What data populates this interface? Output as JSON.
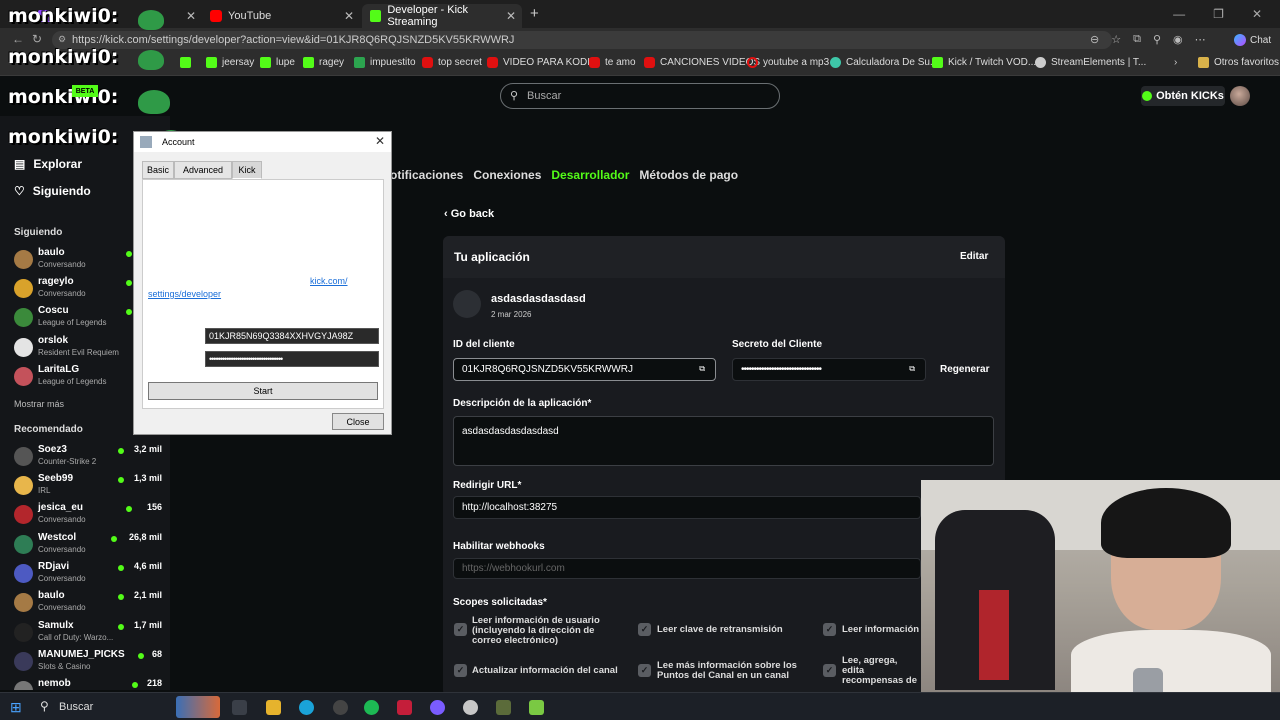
{
  "browser": {
    "tabs": [
      {
        "label": "",
        "favicon_color": "#9146ff"
      },
      {
        "label": "YouTube",
        "favicon_color": "#ff0000"
      },
      {
        "label": "Developer - Kick Streaming",
        "favicon_color": "#53fc18"
      }
    ],
    "url": "https://kick.com/settings/developer?action=view&id=01KJR8Q6RQJSNZD5KV55KRWWRJ",
    "bookmarks": [
      "jeersay",
      "lupe",
      "ragey",
      "impuestito",
      "top secret",
      "VIDEO PARA KODI...",
      "te amo",
      "CANCIONES VIDEOS",
      "youtube a mp3",
      "Calculadora De Su...",
      "Kick / Twitch VOD...",
      "StreamElements | T..."
    ],
    "other_favorites": "Otros favoritos",
    "chat_label": "Chat"
  },
  "header": {
    "search_placeholder": "Buscar",
    "get_kicks": "Obtén KICKs"
  },
  "overlay": {
    "name": "monkiwi0:",
    "beta": "BETA"
  },
  "sidebar": {
    "nav": [
      "Explorar",
      "Siguiendo"
    ],
    "following_title": "Siguiendo",
    "following": [
      {
        "name": "baulo",
        "sub": "Conversando"
      },
      {
        "name": "rageylo",
        "sub": "Conversando"
      },
      {
        "name": "Coscu",
        "sub": "League of Legends"
      },
      {
        "name": "orslok",
        "sub": "Resident Evil Requiem"
      },
      {
        "name": "LaritaLG",
        "sub": "League of Legends"
      }
    ],
    "show_more": "Mostrar más",
    "recommended_title": "Recomendado",
    "recommended": [
      {
        "name": "Soez3",
        "sub": "Counter-Strike 2",
        "viewers": "3,2 mil"
      },
      {
        "name": "Seeb99",
        "sub": "IRL",
        "viewers": "1,3 mil"
      },
      {
        "name": "jesica_eu",
        "sub": "Conversando",
        "viewers": "156"
      },
      {
        "name": "Westcol",
        "sub": "Conversando",
        "viewers": "26,8 mil"
      },
      {
        "name": "RDjavi",
        "sub": "Conversando",
        "viewers": "4,6 mil"
      },
      {
        "name": "baulo",
        "sub": "Conversando",
        "viewers": "2,1 mil"
      },
      {
        "name": "Samulx",
        "sub": "Call of Duty: Warzo...",
        "viewers": "1,7 mil"
      },
      {
        "name": "MANUMEJ_PICKS",
        "sub": "Slots & Casino",
        "viewers": "68"
      },
      {
        "name": "nemob",
        "sub": "",
        "viewers": "218"
      }
    ]
  },
  "settings_tabs": {
    "items": [
      "otificaciones",
      "Conexiones",
      "Desarrollador",
      "Métodos de pago"
    ],
    "active": "Desarrollador"
  },
  "app": {
    "go_back": "Go back",
    "card_title": "Tu aplicación",
    "edit": "Editar",
    "app_name": "asdasdasdasdasd",
    "date": "2 mar 2026",
    "client_id_label": "ID del cliente",
    "client_id": "01KJR8Q6RQJSNZD5KV55KRWWRJ",
    "client_secret_label": "Secreto del Cliente",
    "client_secret": "••••••••••••••••••••••••••••••••",
    "regenerate": "Regenerar",
    "description_label": "Descripción de la aplicación*",
    "description": "asdasdasdasdasdasd",
    "redirect_label": "Redirigir URL*",
    "redirect": "http://localhost:38275",
    "webhooks_label": "Habilitar webhooks",
    "webhooks_placeholder": "https://webhookurl.com",
    "scopes_label": "Scopes solicitadas*",
    "scopes": [
      "Leer información de usuario (incluyendo la dirección de correo electrónico)",
      "Leer clave de retransmisión",
      "Leer información",
      "Actualizar información del canal",
      "Lee más información sobre los Puntos del Canal en un canal",
      "Lee, agrega, edita recompensas de los Canal de un canal"
    ]
  },
  "dialog": {
    "title": "Account",
    "tabs": [
      "Basic",
      "Advanced",
      "Kick"
    ],
    "active_tab": "Kick",
    "link_part1": "kick.com/",
    "link_part2": "settings/developer",
    "client_id_value": "01KJR85N69Q3384XXHVGYJA98Z",
    "secret_value": "••••••••••••••••••••••••••••••••••",
    "start": "Start",
    "close": "Close"
  },
  "taskbar": {
    "search": "Buscar"
  }
}
